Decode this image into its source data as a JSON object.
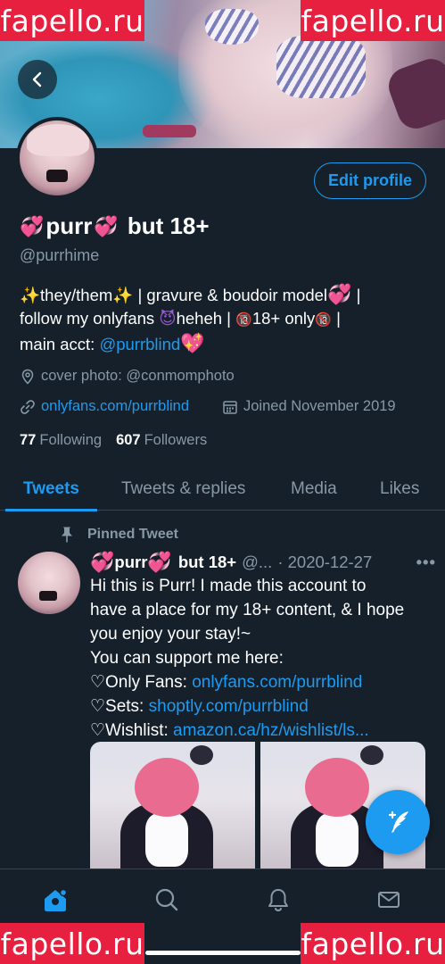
{
  "watermark": "fapello.ru",
  "profile": {
    "edit_button": "Edit profile",
    "name_text": "purr",
    "name_suffix": "but 18+",
    "handle": "@purrhime",
    "bio": {
      "line1_a": "they/them",
      "line1_b": "| gravure & boudoir model",
      "line1_c": "|",
      "line2_a": "follow my onlyfans",
      "line2_b": "heheh |",
      "line2_c": "18+ only",
      "line2_d": "|",
      "line3_a": "main acct:",
      "line3_link": "@purrblind"
    },
    "location": "cover photo: @conmomphoto",
    "website": "onlyfans.com/purrblind",
    "joined": "Joined November 2019",
    "following_count": "77",
    "following_label": "Following",
    "followers_count": "607",
    "followers_label": "Followers"
  },
  "tabs": [
    "Tweets",
    "Tweets & replies",
    "Media",
    "Likes"
  ],
  "tweet": {
    "pinned_label": "Pinned Tweet",
    "author_name": "purr",
    "author_suffix": "but 18+",
    "author_handle": "@...",
    "date": "· 2020-12-27",
    "more": "•••",
    "line1": "Hi this is Purr! I made this account to",
    "line2": "have a place for my 18+ content, & I hope",
    "line3": "you enjoy your stay!~",
    "line4": "You can support me here:",
    "line5_label": "♡Only Fans:",
    "line5_link": "onlyfans.com/purrblind",
    "line6_label": "♡Sets:",
    "line6_link": "shoptly.com/purrblind",
    "line7_label": "♡Wishlist:",
    "line7_link": "amazon.ca/hz/wishlist/ls..."
  },
  "icons": {
    "back": "chevron-left-icon",
    "location": "location-pin-icon",
    "link": "link-icon",
    "calendar": "calendar-icon",
    "pin": "pin-icon",
    "compose": "compose-tweet-icon",
    "home": "home-icon",
    "search": "search-icon",
    "notifications": "bell-icon",
    "messages": "mail-icon"
  },
  "colors": {
    "accent": "#1d9bf0",
    "background": "#15202b",
    "secondary_text": "#8899a6",
    "watermark": "#e8203f"
  }
}
